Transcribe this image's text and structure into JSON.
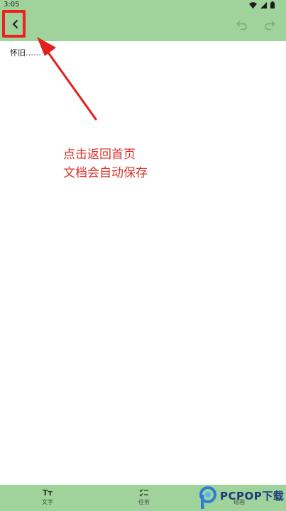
{
  "status_bar": {
    "time": "3:05",
    "icons": [
      "wifi-icon",
      "signal-icon",
      "battery-icon"
    ]
  },
  "app_bar": {
    "back_icon": "chevron-left-icon",
    "undo_icon": "undo-icon",
    "redo_icon": "redo-icon",
    "background_color": "#a0d29c"
  },
  "document": {
    "text": "怀旧……"
  },
  "annotation": {
    "line1": "点击返回首页",
    "line2": "文档会自动保存",
    "color": "#d8322b"
  },
  "bottom_bar": {
    "items": [
      {
        "icon": "text-format-icon",
        "glyph": "Tт",
        "label": "文字"
      },
      {
        "icon": "task-list-icon",
        "glyph": "☑",
        "label": "任务"
      },
      {
        "icon": "draw-icon",
        "glyph": "",
        "label": "绘画"
      }
    ]
  },
  "watermark": {
    "brand": "PCPOP下载"
  }
}
